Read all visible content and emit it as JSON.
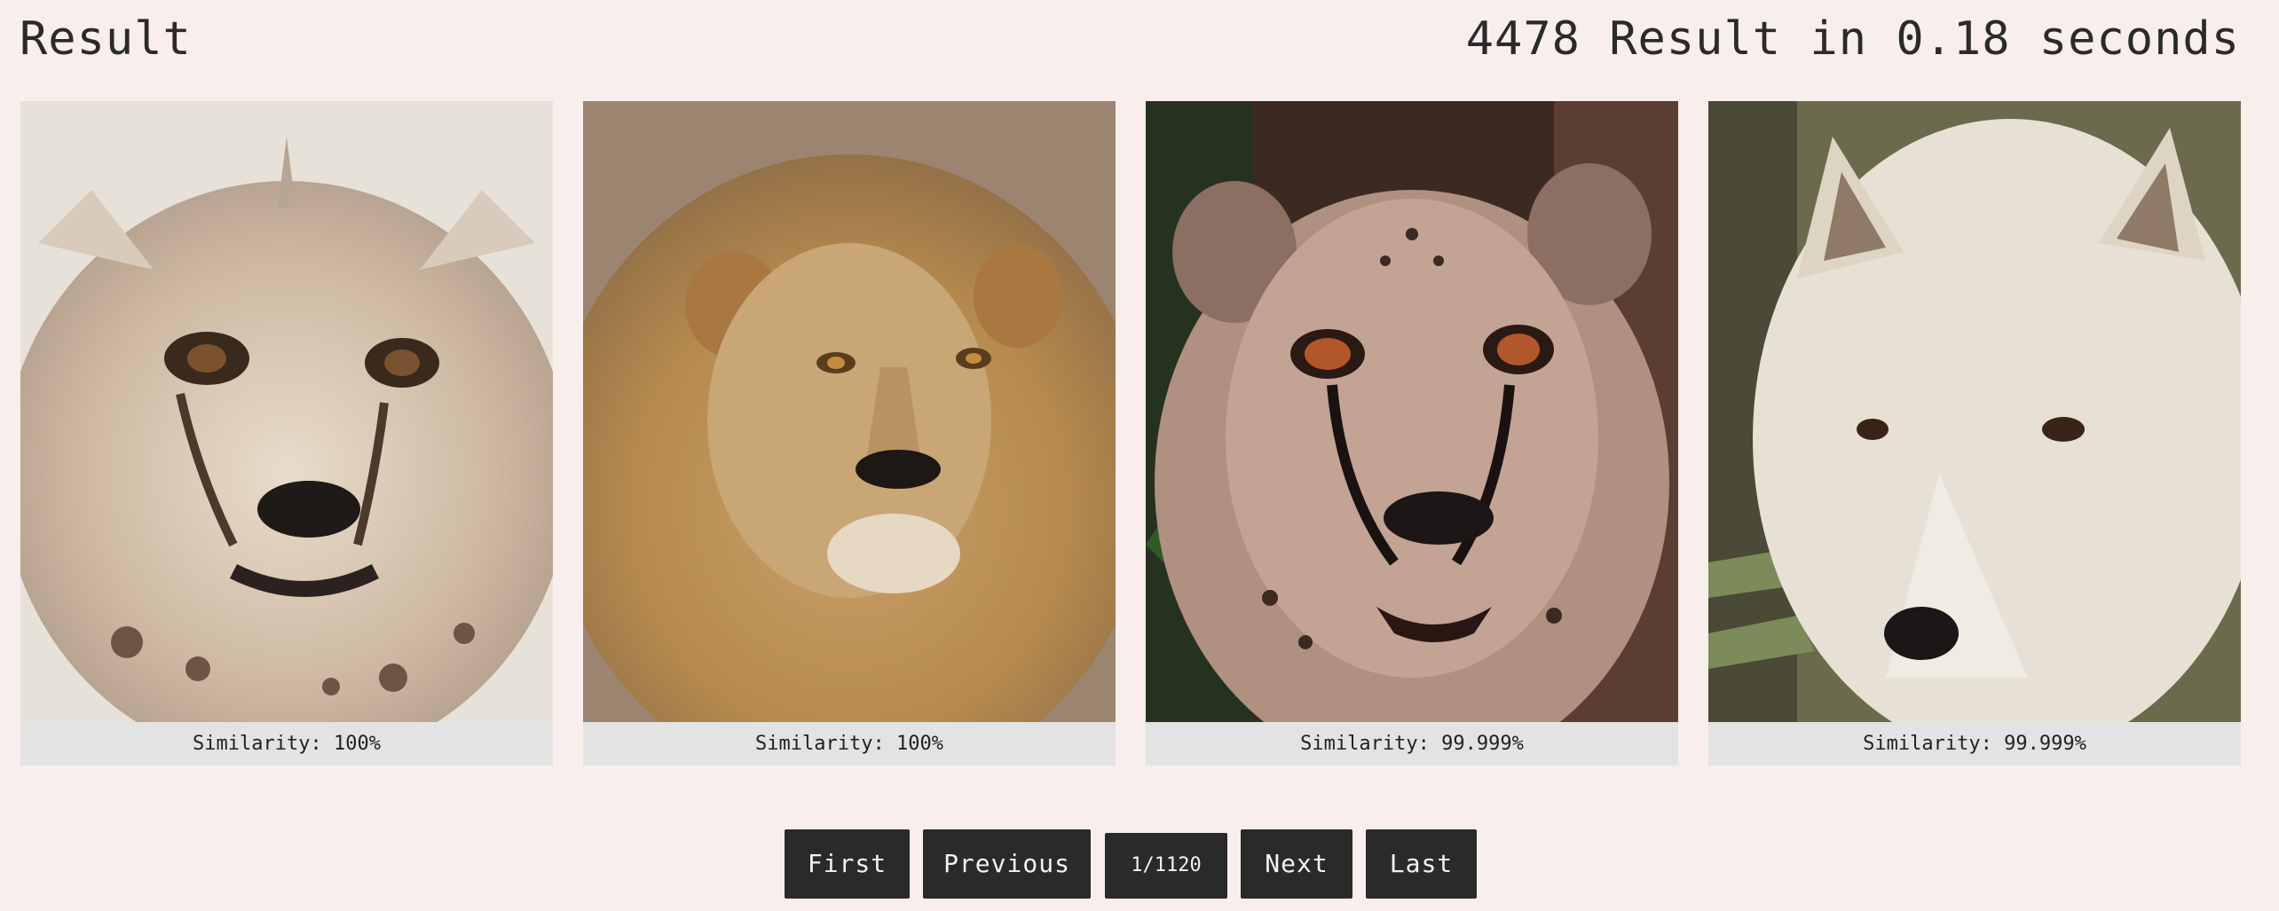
{
  "header": {
    "title": "Result",
    "stats": "4478 Result in 0.18 seconds"
  },
  "results": [
    {
      "caption": "Similarity: 100%",
      "subject": "cheetah-cub"
    },
    {
      "caption": "Similarity: 100%",
      "subject": "lion"
    },
    {
      "caption": "Similarity: 99.999%",
      "subject": "cheetah"
    },
    {
      "caption": "Similarity: 99.999%",
      "subject": "white-wolf"
    }
  ],
  "pagination": {
    "first": "First",
    "previous": "Previous",
    "page": "1/1120",
    "next": "Next",
    "last": "Last"
  },
  "colors": {
    "background": "#f8eeec",
    "caption_bg": "#e3e3e3",
    "button_bg": "#2a2a2a"
  }
}
